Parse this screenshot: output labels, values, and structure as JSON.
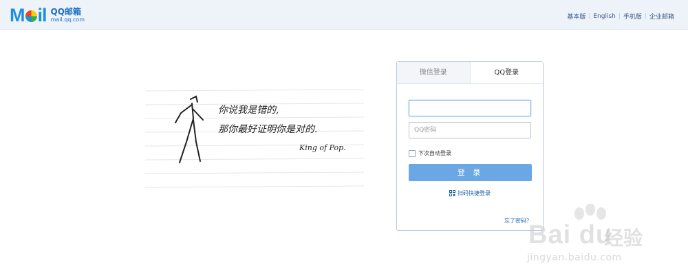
{
  "header": {
    "logo_word": "M  il",
    "logo_title": "QQ邮箱",
    "logo_sub": "mail.qq.com",
    "links": [
      "基本版",
      "English",
      "手机版",
      "企业邮箱"
    ]
  },
  "illustration": {
    "line1": "你说我是错的,",
    "line2": "那你最好证明你是对的.",
    "signature": "King of Pop."
  },
  "login": {
    "tab_wechat": "微信登录",
    "tab_qq": "QQ登录",
    "username_value": "",
    "password_placeholder": "QQ密码",
    "remember_label": "下次自动登录",
    "login_button": "登 录",
    "qr_login": "扫码快捷登录",
    "forgot": "忘了密码？"
  },
  "watermark": {
    "brand": "Bai du",
    "brand_cn": "经验",
    "url": "jingyan.baidu.com"
  },
  "colors": {
    "accent": "#6aa7e4",
    "link": "#1c5fa8",
    "topbar": "#eef3fa"
  }
}
